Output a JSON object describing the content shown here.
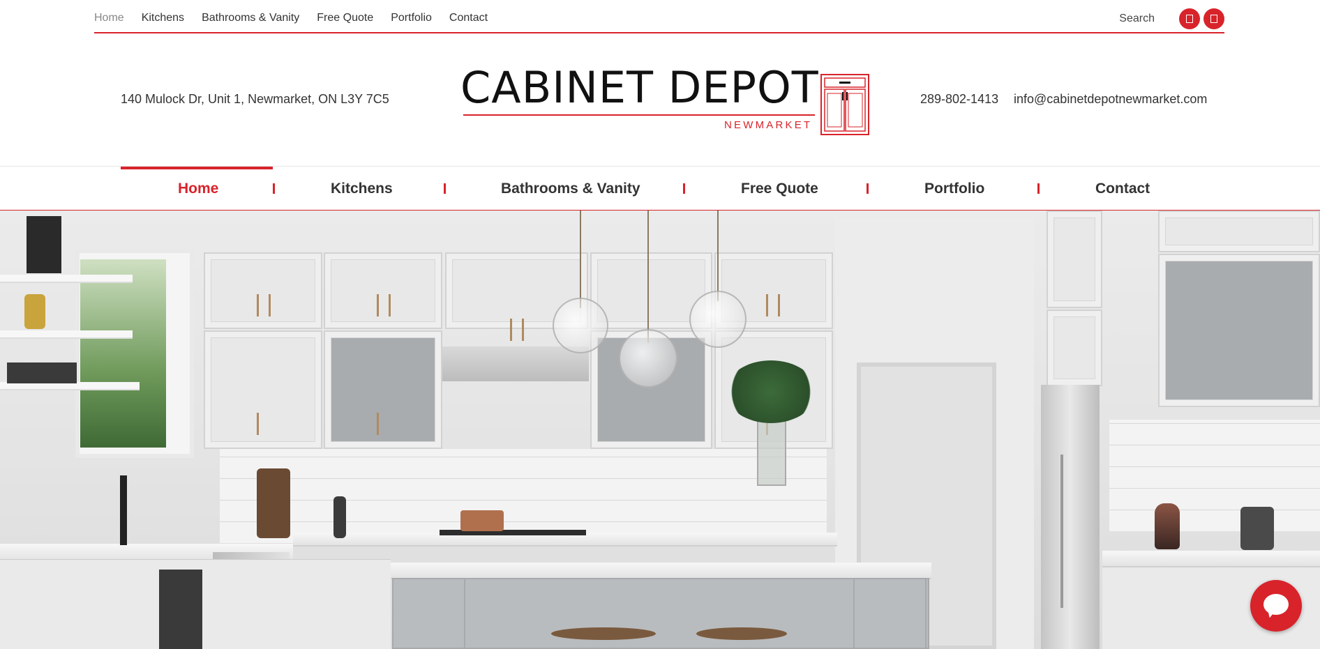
{
  "top_nav": {
    "items": [
      {
        "label": "Home",
        "active": true
      },
      {
        "label": "Kitchens"
      },
      {
        "label": "Bathrooms & Vanity"
      },
      {
        "label": "Free Quote"
      },
      {
        "label": "Portfolio"
      },
      {
        "label": "Contact"
      }
    ],
    "search_label": "Search",
    "social_icons": [
      "facebook-icon",
      "instagram-icon"
    ]
  },
  "header": {
    "address": "140 Mulock Dr, Unit 1, Newmarket, ON L3Y 7C5",
    "phone": "289-802-1413",
    "email": "info@cabinetdepotnewmarket.com",
    "logo": {
      "title": "CABINET DEPOT",
      "subtitle": "NEWMARKET"
    }
  },
  "main_nav": {
    "items": [
      {
        "label": "Home",
        "active": true
      },
      {
        "label": "Kitchens"
      },
      {
        "label": "Bathrooms & Vanity"
      },
      {
        "label": "Free Quote"
      },
      {
        "label": "Portfolio"
      },
      {
        "label": "Contact"
      }
    ]
  },
  "colors": {
    "accent": "#d8232a",
    "text": "#333333",
    "muted": "#888888"
  },
  "chat": {
    "icon": "chat-bubble-icon"
  }
}
